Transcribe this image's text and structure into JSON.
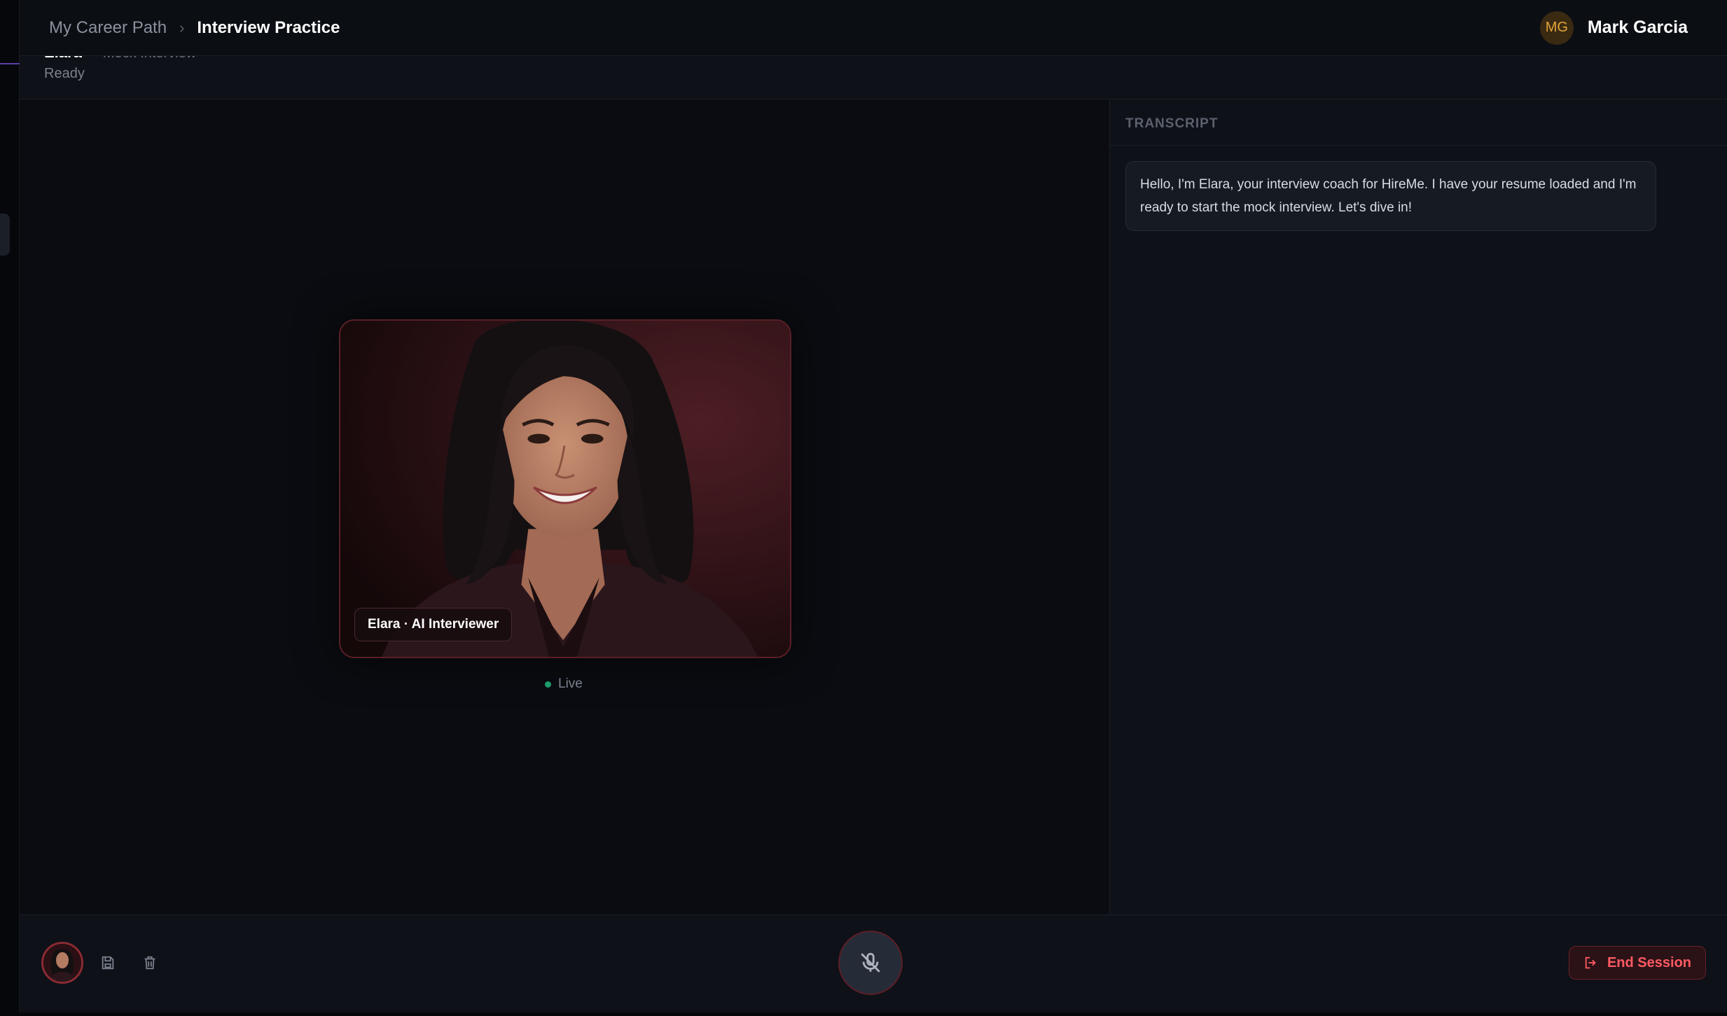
{
  "breadcrumb": {
    "parent": "My Career Path",
    "separator": "›",
    "current": "Interview Practice"
  },
  "user": {
    "initials": "MG",
    "name": "Mark Garcia"
  },
  "session": {
    "interviewer_name": "Elara",
    "type": "Mock Interview",
    "status": "Ready"
  },
  "video": {
    "label": "Elara · AI Interviewer",
    "live_label": "Live"
  },
  "transcript": {
    "heading": "TRANSCRIPT",
    "messages": [
      {
        "text": "Hello, I'm Elara, your interview coach for HireMe. I have your resume loaded and I'm ready to start the mock interview. Let's dive in!"
      }
    ]
  },
  "controls": {
    "end_session_label": "End Session",
    "icons": [
      "save-icon",
      "trash-icon",
      "mic-off-icon",
      "exit-icon"
    ]
  },
  "colors": {
    "background": "#0a0c11",
    "panel": "#0e1117",
    "accent_red": "#ff5a63",
    "live_green": "#1e9c6c",
    "avatar_orange": "#e4a53a"
  }
}
